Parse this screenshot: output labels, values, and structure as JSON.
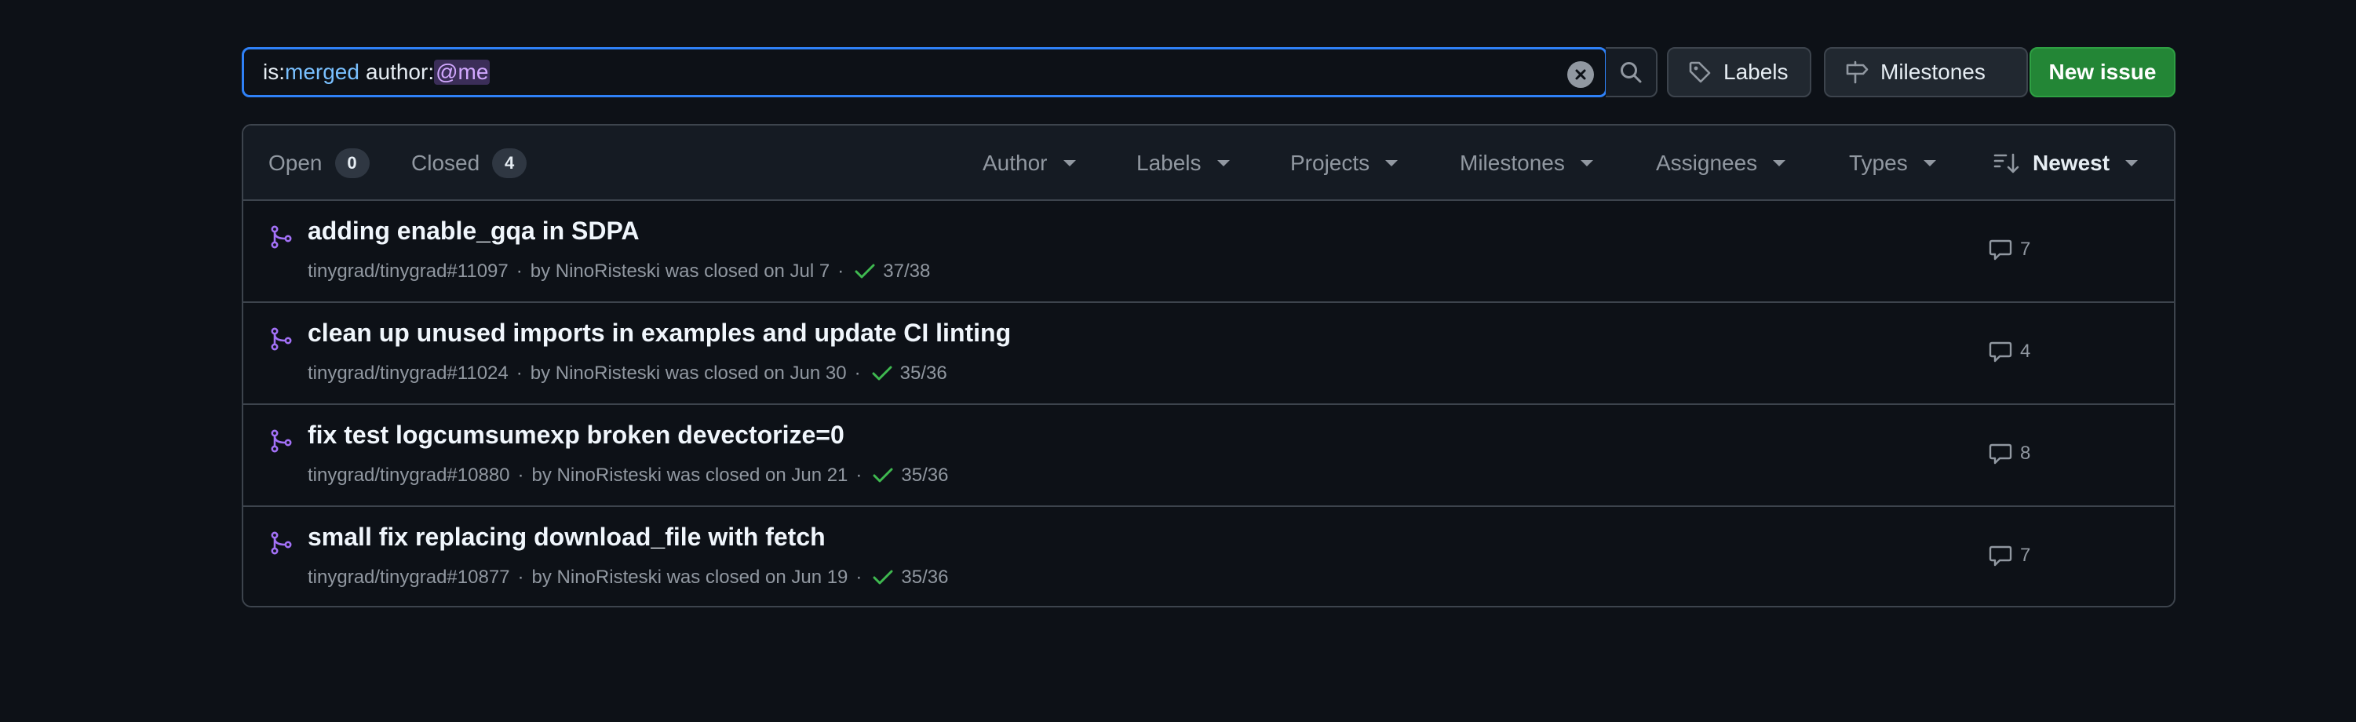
{
  "search": {
    "key_is": "is:",
    "value_is": "merged",
    "key_author": "author:",
    "value_author": "@me"
  },
  "toolbar": {
    "labels_label": "Labels",
    "milestones_label": "Milestones",
    "new_issue_label": "New issue"
  },
  "states": {
    "open_label": "Open",
    "open_count": "0",
    "closed_label": "Closed",
    "closed_count": "4"
  },
  "filters": {
    "author": "Author",
    "labels": "Labels",
    "projects": "Projects",
    "milestones": "Milestones",
    "assignees": "Assignees",
    "types": "Types",
    "sort": "Newest"
  },
  "items": [
    {
      "title": "adding enable_gqa in SDPA",
      "ref": "tinygrad/tinygrad#11097",
      "byline": "by NinoRisteski was closed on Jul 7",
      "checks": "37/38",
      "comments": "7"
    },
    {
      "title": "clean up unused imports in examples and update CI linting",
      "ref": "tinygrad/tinygrad#11024",
      "byline": "by NinoRisteski was closed on Jun 30",
      "checks": "35/36",
      "comments": "4"
    },
    {
      "title": "fix test logcumsumexp broken devectorize=0",
      "ref": "tinygrad/tinygrad#10880",
      "byline": "by NinoRisteski was closed on Jun 21",
      "checks": "35/36",
      "comments": "8"
    },
    {
      "title": "small fix replacing download_file with fetch",
      "ref": "tinygrad/tinygrad#10877",
      "byline": "by NinoRisteski was closed on Jun 19",
      "checks": "35/36",
      "comments": "7"
    }
  ],
  "colors": {
    "background": "#0d1117",
    "accent_blue": "#2f81f7",
    "merged_purple": "#a371f7",
    "success_green": "#3fb950",
    "primary_button": "#238636"
  },
  "icons": {
    "clear": "x-circle-icon",
    "search": "search-icon",
    "labels": "tag-icon",
    "milestones": "milestone-icon",
    "sort": "sort-desc-icon",
    "pr": "git-merge-icon",
    "check": "check-icon",
    "comment": "comment-icon"
  }
}
